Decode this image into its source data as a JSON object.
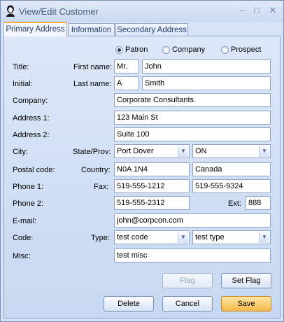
{
  "window": {
    "title": "View/Edit Customer"
  },
  "tabs": [
    {
      "label": "Primary Address"
    },
    {
      "label": "Information"
    },
    {
      "label": "Secondary Address"
    }
  ],
  "customer_type": {
    "options": [
      "Patron",
      "Company",
      "Prospect"
    ],
    "selected": "Patron"
  },
  "labels": {
    "title": "Title:",
    "first_name": "First name:",
    "initial": "Initial:",
    "last_name": "Last name:",
    "company": "Company:",
    "address1": "Address 1:",
    "address2": "Address 2:",
    "city": "City:",
    "state_prov": "State/Prov:",
    "postal_code": "Postal code:",
    "country": "Country:",
    "phone1": "Phone 1:",
    "fax": "Fax:",
    "phone2": "Phone 2:",
    "ext": "Ext:",
    "email": "E-mail:",
    "code": "Code:",
    "type": "Type:",
    "misc": "Misc:"
  },
  "values": {
    "title": "Mr.",
    "first_name": "John",
    "initial": "A",
    "last_name": "Smith",
    "company": "Corporate Consultants",
    "address1": "123 Main St",
    "address2": "Suite 100",
    "city": "Port Dover",
    "state_prov": "ON",
    "postal_code": "N0A 1N4",
    "country": "Canada",
    "phone1": "519-555-1212",
    "fax": "519-555-9324",
    "phone2": "519-555-2312",
    "ext": "888",
    "email": "john@corpcon.com",
    "code": "test code",
    "type": "test type",
    "misc": "test misc"
  },
  "buttons": {
    "flag": "Flag",
    "set_flag": "Set Flag",
    "delete": "Delete",
    "cancel": "Cancel",
    "save": "Save"
  },
  "icons": {
    "app": "customer-icon",
    "minimize": "minimize-icon",
    "maximize": "maximize-icon",
    "close": "close-icon"
  }
}
